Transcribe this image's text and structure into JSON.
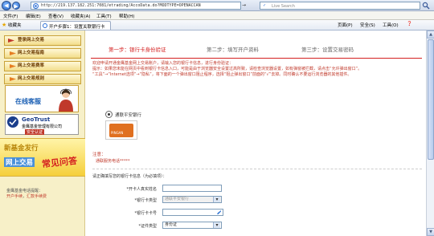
{
  "browser": {
    "url": "http://219.137.182.251:7081/etrading/AccoData.do?MODTYPE=OPENACCAN",
    "go_label": "→",
    "search_placeholder": "Live Search",
    "search_brand": "✓"
  },
  "menu": {
    "items": [
      "文件(F)",
      "编辑(E)",
      "查看(V)",
      "收藏夹(A)",
      "工具(T)",
      "帮助(H)"
    ]
  },
  "favorites_bar": {
    "fav_label": "收藏夹",
    "tab_label": "开户步骤1：设置关联银行卡",
    "right_items": [
      "页面(P)",
      "安全(S)",
      "工具(O)",
      "❓"
    ]
  },
  "sidebar": {
    "items": [
      "登录网上交易",
      "网上交易指南",
      "网上交易费率",
      "网上交易规则"
    ],
    "service_label": "在线客服",
    "geotrust_title": "GeoTrust",
    "geotrust_company": "金鹰基金管理有限公司",
    "geotrust_cert": "安全认证",
    "promo_line1": "新基金发行",
    "promo_line2": "网上交易",
    "promo_line3": "常见问答",
    "note_line1": "金鹰基金电话提醒：",
    "note_line2": "开户手续",
    "note_line3": "，",
    "note_line4": "汇款手续费"
  },
  "steps": {
    "step1": "第一步：银行卡身份验证",
    "step2": "第二步：填写开户资料",
    "step3": "第三步：设置交易密码"
  },
  "intro": {
    "line1": "欢迎申请开通金鹰基金网上交易账户，请输入您的银行卡信息，进行身份验证：",
    "line2": "提示：如果您未能在网页中看到银行卡信息入口，可能是由于浏览器安全设置过高所致，请检查浏览器设置，如有弹窗被拦截，请点击“允许弹出窗口”。",
    "line3": "“工具”→“Internet选项”→“隐私”，将下面的一个弹出窗口阻止程序，选择“阻止弹出窗口”前面的“√”去掉。同时确认不要运行浏览器的其他插件。"
  },
  "bank": {
    "name": "通联平安银行",
    "logo_text": "PINGAN"
  },
  "notes": {
    "label": "注意：",
    "text": "通联服务电话*****"
  },
  "form": {
    "intro": "请正确填写您的银行卡信息（为必填项）：",
    "fields": [
      {
        "label": "*开卡人真实姓名",
        "value": ""
      },
      {
        "label": "*银行卡类型",
        "value": "通联平安银行"
      },
      {
        "label": "*银行卡卡号",
        "value": ""
      },
      {
        "label": "*证件类型",
        "value": "身份证"
      }
    ]
  }
}
